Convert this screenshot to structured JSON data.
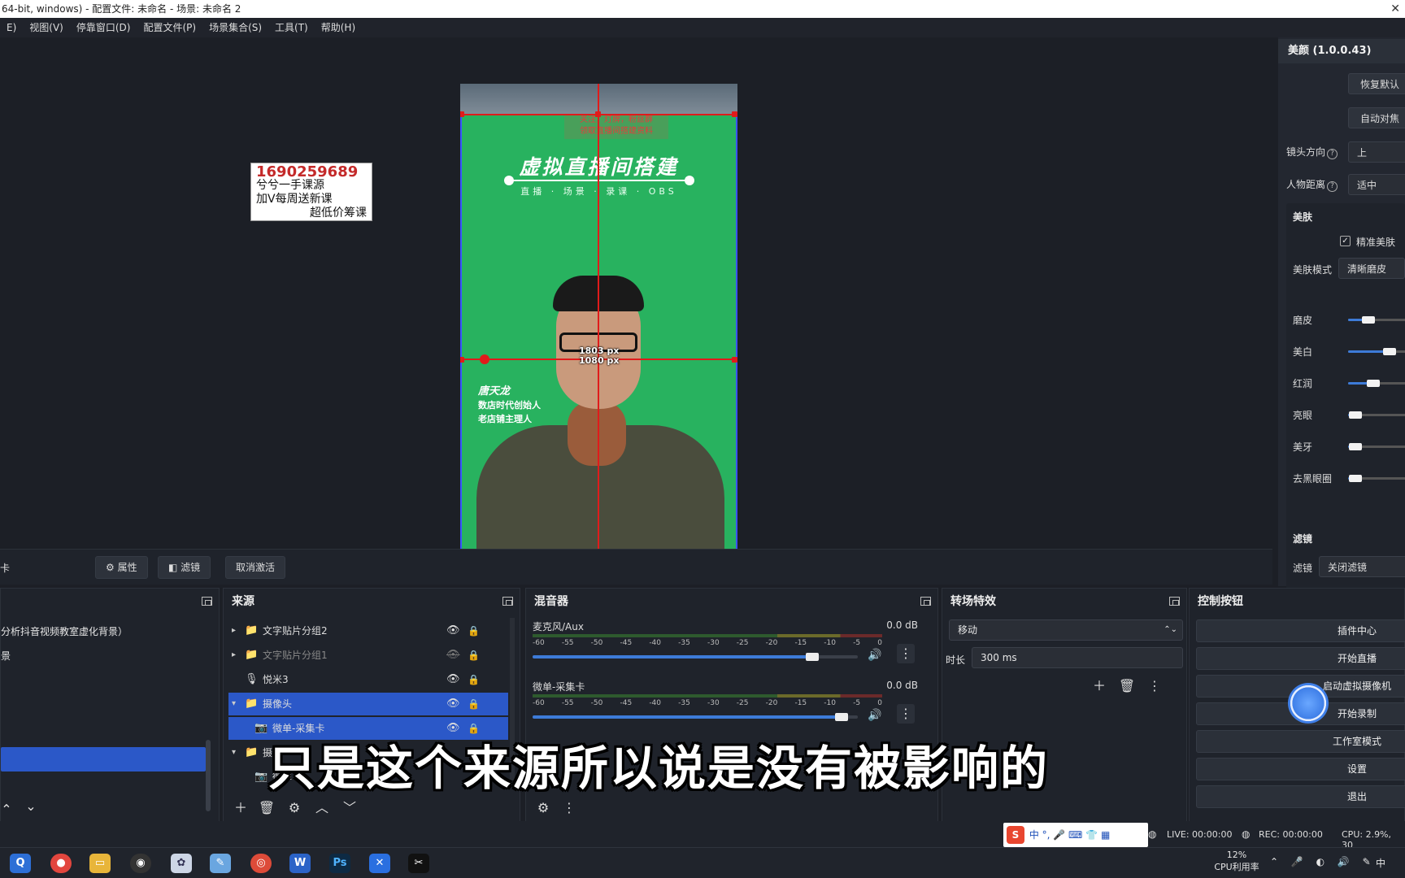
{
  "window": {
    "title": "64-bit, windows) - 配置文件: 未命名 - 场景: 未命名 2",
    "close_glyph": "✕"
  },
  "menu": [
    "E)",
    "视图(V)",
    "停靠窗口(D)",
    "配置文件(P)",
    "场景集合(S)",
    "工具(T)",
    "帮助(H)"
  ],
  "preview": {
    "watermark_number": "1690259689",
    "watermark_line1": "兮兮一手课源",
    "watermark_line2": "加V每周送新课",
    "watermark_line3": "超低价筹课",
    "banner_line1": "关注，灯牌，粉丝群",
    "banner_line2": "领取直播间搭建资料",
    "headline": "虚拟直播间搭建",
    "subline": "直播 · 场景 · 录课 · OBS",
    "name": "唐天龙",
    "name_role1": "数店时代创始人",
    "name_role2": "老店铺主理人",
    "width_label": "1080 px",
    "height_label": "1803 px"
  },
  "beauty": {
    "title": "美颜 (1.0.0.43)",
    "reset_btn": "恢复默认",
    "auto_focus_btn": "自动对焦",
    "cam_dir_label": "镜头方向",
    "cam_dir_value": "上",
    "distance_label": "人物距离",
    "distance_value": "适中",
    "help_glyph": "?",
    "skin_title": "美肤",
    "precise_label": "精准美肤",
    "skin_mode_label": "美肤模式",
    "skin_mode_value": "清晰磨皮",
    "sliders": [
      {
        "label": "磨皮",
        "value": 0.28
      },
      {
        "label": "美白",
        "value": 0.62
      },
      {
        "label": "红润",
        "value": 0.35
      },
      {
        "label": "亮眼",
        "value": 0.06
      },
      {
        "label": "美牙",
        "value": 0.06
      },
      {
        "label": "去黑眼圈",
        "value": 0.06
      }
    ],
    "filter_title": "滤镜",
    "filter_label": "滤镜",
    "filter_value": "关闭滤镜"
  },
  "preview_bar": {
    "left_label": "卡",
    "properties": "属性",
    "filters": "滤镜",
    "deactivate": "取消激活"
  },
  "scenes": {
    "item1": "分析抖音视频教室虚化背景）",
    "item2": "景"
  },
  "sources": {
    "title": "来源",
    "rows": [
      {
        "label": "文字贴片分组2",
        "dim": false,
        "caret": "▸",
        "icon": "📁"
      },
      {
        "label": "文字贴片分组1",
        "dim": true,
        "caret": "▸",
        "icon": "📁"
      },
      {
        "label": "悦米3",
        "dim": false,
        "caret": "",
        "icon": "🎙"
      },
      {
        "label": "摄像头",
        "dim": false,
        "caret": "▾",
        "icon": "📁"
      },
      {
        "label": "微单-采集卡",
        "dim": false,
        "caret": "",
        "icon": "📷"
      },
      {
        "label": "摄像",
        "dim": false,
        "caret": "▾",
        "icon": "📁"
      },
      {
        "label": "微单",
        "dim": false,
        "caret": "",
        "icon": "📷"
      }
    ]
  },
  "mixer": {
    "title": "混音器",
    "scale": [
      "-60",
      "-55",
      "-50",
      "-45",
      "-40",
      "-35",
      "-30",
      "-25",
      "-20",
      "-15",
      "-10",
      "-5",
      "0"
    ],
    "channels": [
      {
        "name": "麦克风/Aux",
        "db": "0.0 dB",
        "level": 0.86
      },
      {
        "name": "微单-采集卡",
        "db": "0.0 dB",
        "level": 0.95
      }
    ]
  },
  "transitions": {
    "title": "转场特效",
    "type": "移动",
    "duration_label": "时长",
    "duration_value": "300 ms"
  },
  "controls": {
    "title": "控制按钮",
    "buttons": [
      "插件中心",
      "开始直播",
      "启动虚拟摄像机",
      "开始录制",
      "工作室模式",
      "设置",
      "退出"
    ]
  },
  "status": {
    "live": "LIVE: 00:00:00",
    "rec": "REC: 00:00:00",
    "cpu": "CPU: 2.9%, 30"
  },
  "taskbar": {
    "cpu_percent": "12%",
    "cpu_label": "CPU利用率",
    "ime_lang": "中",
    "tray_lang": "中"
  },
  "caption": "只是这个来源所以说是没有被影响的"
}
